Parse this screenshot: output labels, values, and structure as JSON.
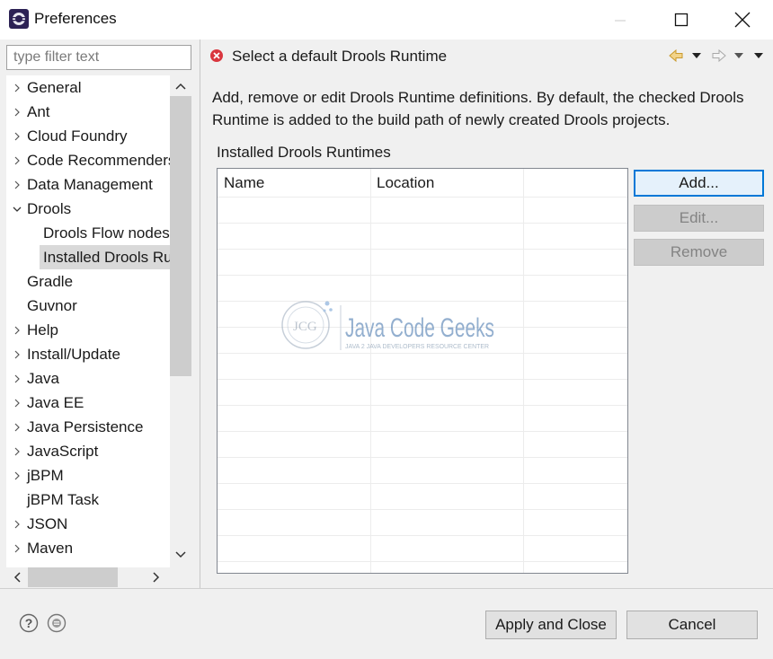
{
  "window": {
    "title": "Preferences",
    "controls": [
      "minimize",
      "maximize",
      "close"
    ]
  },
  "filter": {
    "placeholder": "type filter text",
    "value": ""
  },
  "tree": {
    "items": [
      {
        "label": "General",
        "expander": "collapsed",
        "level": 0
      },
      {
        "label": "Ant",
        "expander": "collapsed",
        "level": 0
      },
      {
        "label": "Cloud Foundry",
        "expander": "collapsed",
        "level": 0
      },
      {
        "label": "Code Recommenders",
        "expander": "collapsed",
        "level": 0
      },
      {
        "label": "Data Management",
        "expander": "collapsed",
        "level": 0
      },
      {
        "label": "Drools",
        "expander": "expanded",
        "level": 0
      },
      {
        "label": "Drools Flow nodes",
        "expander": "none",
        "level": 1
      },
      {
        "label": "Installed Drools Runtimes",
        "expander": "none",
        "level": 1,
        "selected": true
      },
      {
        "label": "Gradle",
        "expander": "none",
        "level": 0
      },
      {
        "label": "Guvnor",
        "expander": "none",
        "level": 0
      },
      {
        "label": "Help",
        "expander": "collapsed",
        "level": 0
      },
      {
        "label": "Install/Update",
        "expander": "collapsed",
        "level": 0
      },
      {
        "label": "Java",
        "expander": "collapsed",
        "level": 0
      },
      {
        "label": "Java EE",
        "expander": "collapsed",
        "level": 0
      },
      {
        "label": "Java Persistence",
        "expander": "collapsed",
        "level": 0
      },
      {
        "label": "JavaScript",
        "expander": "collapsed",
        "level": 0
      },
      {
        "label": "jBPM",
        "expander": "collapsed",
        "level": 0
      },
      {
        "label": "jBPM Task",
        "expander": "none",
        "level": 0
      },
      {
        "label": "JSON",
        "expander": "collapsed",
        "level": 0
      },
      {
        "label": "Maven",
        "expander": "collapsed",
        "level": 0
      }
    ]
  },
  "page": {
    "title": "Select a default Drools Runtime",
    "status_icon": "error-icon",
    "description": "Add, remove or edit Drools Runtime definitions. By default, the checked Drools Runtime is added to the build path of newly created Drools projects.",
    "runtimes_label": "Installed Drools Runtimes",
    "table": {
      "columns": [
        "Name",
        "Location",
        ""
      ],
      "rows": []
    },
    "buttons": {
      "add": "Add...",
      "edit": "Edit...",
      "remove": "Remove"
    }
  },
  "watermark": {
    "brand": "Java Code Geeks",
    "tagline": "JAVA 2 JAVA DEVELOPERS RESOURCE CENTER",
    "logo_text": "JCG"
  },
  "footer": {
    "apply_close": "Apply and Close",
    "cancel": "Cancel"
  },
  "colors": {
    "accent": "#0078d7",
    "selection": "#d9d9d9",
    "error": "#d9363e",
    "watermark": "#3b6ea8"
  }
}
